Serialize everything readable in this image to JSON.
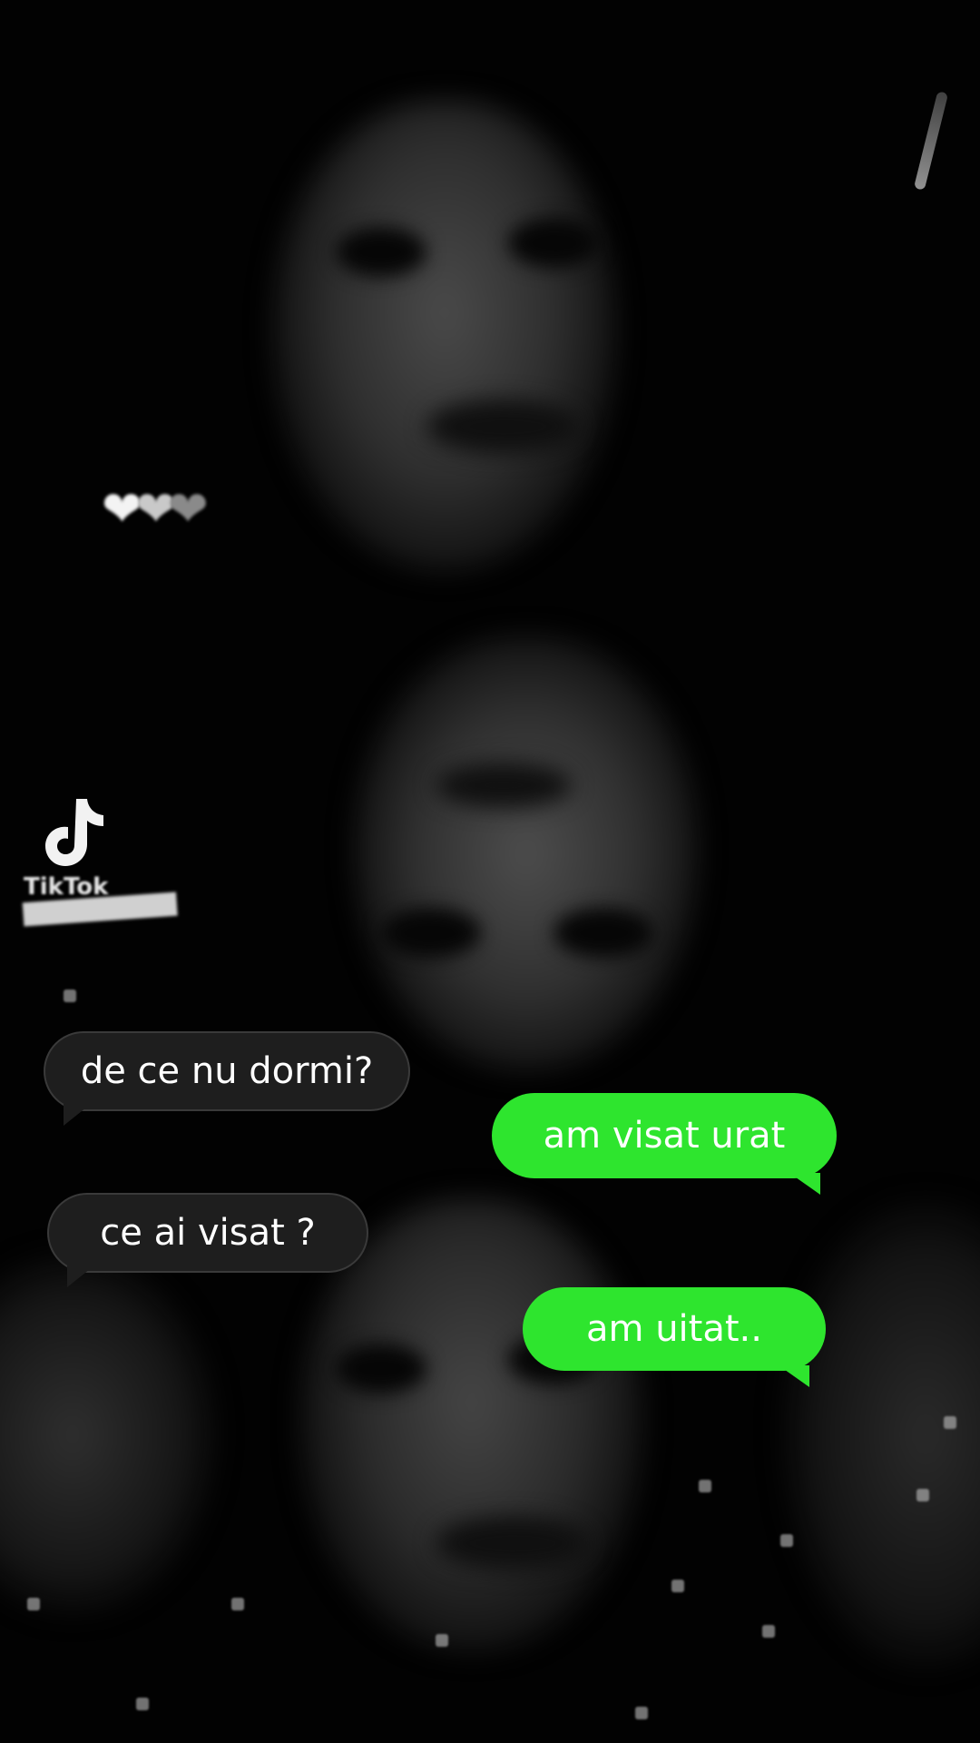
{
  "watermark": {
    "brand": "TikTok",
    "logo_icon": "tiktok-logo-icon"
  },
  "decorations": {
    "hearts": [
      "white-heart-icon",
      "grey-heart-icon",
      "dark-heart-icon"
    ]
  },
  "messages": [
    {
      "sender": "them",
      "text": "de ce nu dormi?"
    },
    {
      "sender": "me",
      "text": "am visat urat"
    },
    {
      "sender": "them",
      "text": "ce ai visat ?"
    },
    {
      "sender": "me",
      "text": "am uitat.."
    }
  ],
  "colors": {
    "outgoing_bubble": "#2ee52e",
    "incoming_bubble": "#1e1e1e",
    "background": "#000000"
  }
}
